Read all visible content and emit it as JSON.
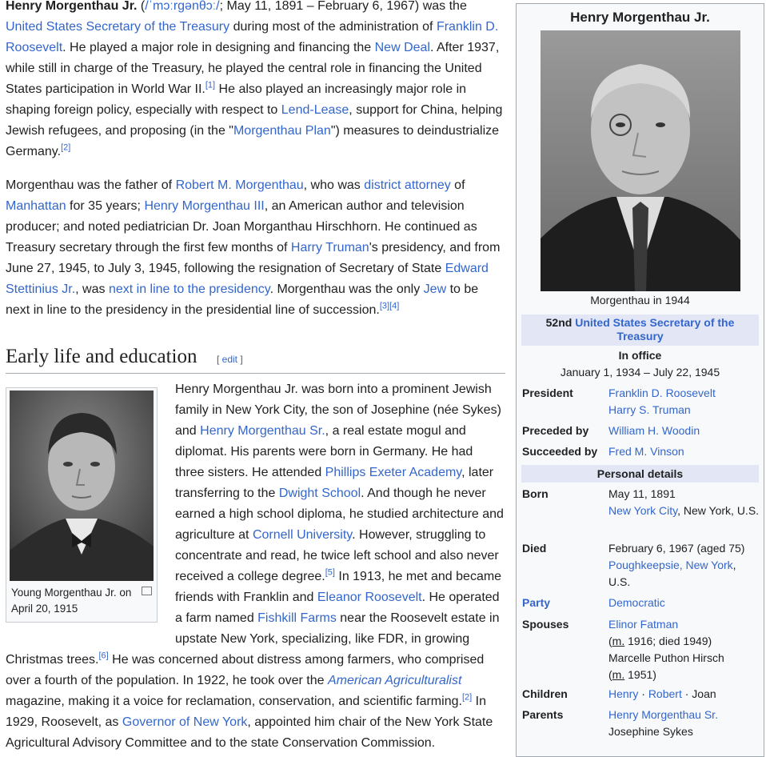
{
  "lead1": {
    "name": "Henry Morgenthau Jr.",
    "ipa": "/ˈmɔːrɡənθɔː/",
    "t1": "; May 11, 1891 – February 6, 1967) was the ",
    "l1": "United States Secretary of the Treasury",
    "t2": " during most of the administration of ",
    "l2": "Franklin D. Roosevelt",
    "t3": ". He played a major role in designing and financing the ",
    "l3": "New Deal",
    "t4": ". After 1937, while still in charge of the Treasury, he played the central role in financing the United States participation in World War II.",
    "ref1": "[1]",
    "t5": " He also played an increasingly major role in shaping foreign policy, especially with respect to ",
    "l4": "Lend-Lease",
    "t6": ", support for China, helping Jewish refugees, and proposing (in the \"",
    "l5": "Morgenthau Plan",
    "t7": "\") measures to deindustrialize Germany.",
    "ref2": "[2]"
  },
  "lead2": {
    "t1": "Morgenthau was the father of ",
    "l1": "Robert M. Morgenthau",
    "t2": ", who was ",
    "l2": "district attorney",
    "t3": " of ",
    "l3": "Manhattan",
    "t4": " for 35 years; ",
    "l4": "Henry Morgenthau III",
    "t5": ", an American author and television producer; and noted pediatrician Dr. Joan Morganthau Hirschhorn. He continued as Treasury secretary through the first few months of ",
    "l5": "Harry Truman",
    "t6": "'s presidency, and from June 27, 1945, to July 3, 1945, following the resignation of Secretary of State ",
    "l6": "Edward Stettinius Jr.",
    "t7": ", was ",
    "l7": "next in line to the presidency",
    "t8": ". Morgenthau was the only ",
    "l8": "Jew",
    "t9": " to be next in line to the presidency in the presidential line of succession.",
    "ref3": "[3]",
    "ref4": "[4]"
  },
  "section": {
    "title": "Early life and education",
    "edit_open": "[ ",
    "edit": "edit",
    "edit_close": " ]"
  },
  "thumb": {
    "caption": "Young Morgenthau Jr. on April 20, 1915"
  },
  "early": {
    "t1": "Henry Morgenthau Jr. was born into a prominent Jewish family in New York City, the son of Josephine (née Sykes) and ",
    "l1": "Henry Morgenthau Sr.",
    "t2": ", a real estate mogul and diplomat. His parents were born in Germany. He had three sisters. He attended ",
    "l2": "Phillips Exeter Academy",
    "t3": ", later transferring to the ",
    "l3": "Dwight School",
    "t4": ". And though he never earned a high school diploma, he studied architecture and agriculture at ",
    "l4": "Cornell University",
    "t5": ". However, struggling to concentrate and read, he twice left school and also never received a college degree.",
    "ref5": "[5]",
    "t6": " In 1913, he met and became friends with Franklin and ",
    "l5": "Eleanor Roosevelt",
    "t7": ". He operated a farm named ",
    "l6": "Fishkill Farms",
    "t8": " near the Roosevelt estate in upstate New York, specializing, like FDR, in growing Christmas trees.",
    "ref6": "[6]",
    "t9": " He was concerned about distress among farmers, who comprised over a fourth of the population. In 1922, he took over the ",
    "l7": "American Agriculturalist",
    "t10": " magazine, making it a voice for reclamation, conservation, and scientific farming.",
    "ref2": "[2]",
    "t11": " In 1929, Roosevelt, as ",
    "l8": "Governor of New York",
    "t12": ", appointed him chair of the New York State Agricultural Advisory Committee and to the state Conservation Commission."
  },
  "infobox": {
    "title": "Henry Morgenthau Jr.",
    "caption": "Morgenthau in 1944",
    "office_prefix": "52nd ",
    "office_link": "United States Secretary of the Treasury",
    "in_office": "In office",
    "dates": "January 1, 1934 – July 22, 1945",
    "president_label": "President",
    "president1": "Franklin D. Roosevelt",
    "president2": "Harry S. Truman",
    "preceded_label": "Preceded by",
    "preceded": "William H. Woodin",
    "succeeded_label": "Succeeded by",
    "succeeded": "Fred M. Vinson",
    "personal_header": "Personal details",
    "born_label": "Born",
    "born_date": "May 11, 1891",
    "born_place_link": "New York City",
    "born_place_rest": ", New York, U.S.",
    "died_label": "Died",
    "died_date": "February 6, 1967 (aged 75)",
    "died_place_link": "Poughkeepsie, New York",
    "died_place_rest": ", U.S.",
    "party_label": "Party",
    "party": "Democratic",
    "spouses_label": "Spouses",
    "spouse1": "Elinor Fatman",
    "spouse1_m": "m.",
    "spouse1_detail": " 1916; died 1949)",
    "spouse2": "Marcelle Puthon Hirsch",
    "spouse2_m": "m.",
    "spouse2_detail": " 1951)",
    "children_label": "Children",
    "child1": "Henry",
    "child2": "Robert",
    "child3": "Joan",
    "sep": " · ",
    "parents_label": "Parents",
    "parent1": "Henry Morgenthau Sr.",
    "parent2": "Josephine Sykes"
  },
  "colors": {
    "link": "#3366cc",
    "text": "#202122",
    "infobox_header_bg": "#e3e6f5",
    "infobox_bg": "#f8f9fa"
  }
}
